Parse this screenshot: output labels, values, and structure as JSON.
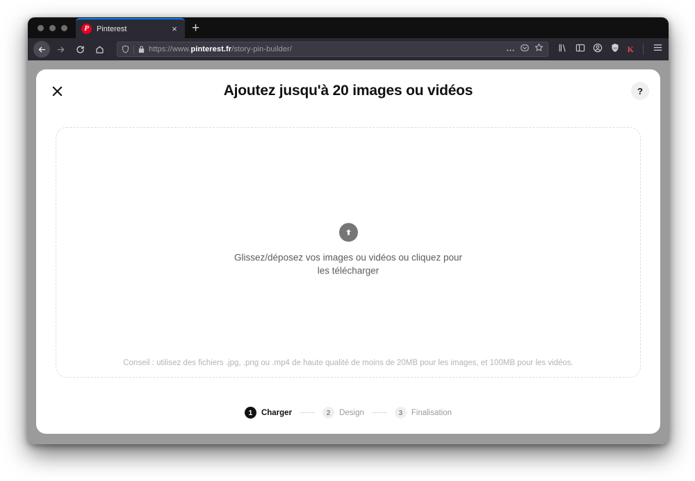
{
  "browser": {
    "traffic_lights": [
      "close",
      "minimize",
      "maximize"
    ],
    "tab": {
      "favicon_letter": "P",
      "title": "Pinterest",
      "close_label": "×",
      "favicon_icon": "pinterest-favicon"
    },
    "new_tab_label": "+",
    "nav": {
      "back_icon": "back-arrow-icon",
      "forward_icon": "forward-arrow-icon",
      "reload_icon": "reload-icon",
      "home_icon": "home-icon"
    },
    "url": {
      "shield_icon": "tracking-protection-shield-icon",
      "lock_icon": "padlock-icon",
      "scheme": "https://www.",
      "domain": "pinterest.fr",
      "path": "/story-pin-builder/",
      "full": "https://www.pinterest.fr/story-pin-builder/",
      "page_actions_icon": "ellipsis-icon",
      "pocket_icon": "pocket-icon",
      "bookmark_icon": "star-bookmark-icon"
    },
    "toolbar": {
      "library_icon": "library-icon",
      "sidebar_icon": "sidebar-icon",
      "account_icon": "account-avatar-icon",
      "extension_icon": "shield-extension-icon",
      "profile_letter": "K",
      "menu_icon": "hamburger-menu-icon"
    }
  },
  "modal": {
    "close_label": "✕",
    "title": "Ajoutez jusqu'à 20 images ou vidéos",
    "help_label": "?",
    "dropzone": {
      "upload_icon": "upload-arrow-icon",
      "text": "Glissez/déposez vos images ou vidéos ou cliquez pour les télécharger",
      "hint": "Conseil : utilisez des fichiers .jpg, .png ou .mp4 de haute qualité de moins de 20MB pour les images, et 100MB pour les vidéos."
    },
    "stepper": {
      "steps": [
        {
          "num": "1",
          "label": "Charger",
          "state": "active"
        },
        {
          "num": "2",
          "label": "Design",
          "state": "inactive"
        },
        {
          "num": "3",
          "label": "Finalisation",
          "state": "inactive"
        }
      ]
    }
  },
  "colors": {
    "brand_red": "#e60023",
    "active_tab_accent": "#0a84ff",
    "chrome_dark": "#2b2a33",
    "step_active": "#111111"
  }
}
